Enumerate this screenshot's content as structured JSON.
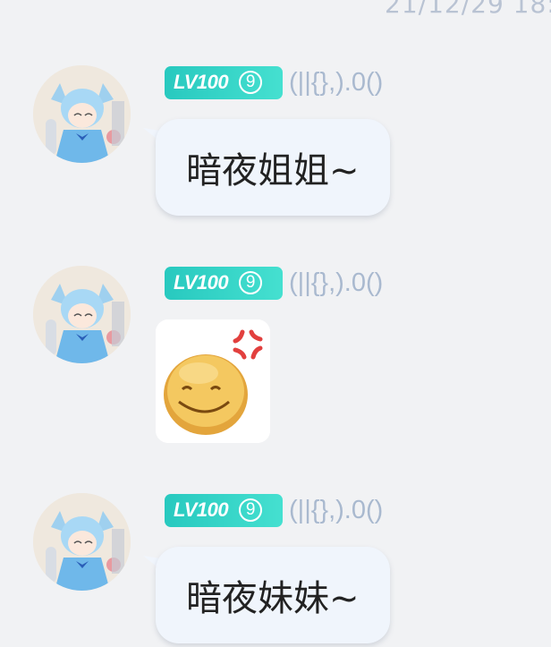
{
  "header": {
    "timestamp": "21/12/29 18:"
  },
  "messages": [
    {
      "type": "text",
      "level": "LV100",
      "level_icon": "9",
      "nickname": "(||{},).0()",
      "text": "暗夜姐姐~"
    },
    {
      "type": "sticker",
      "level": "LV100",
      "level_icon": "9",
      "nickname": "(||{},).0()",
      "sticker": "angry-smiley-face-sticker"
    },
    {
      "type": "text",
      "level": "LV100",
      "level_icon": "9",
      "nickname": "(||{},).0()",
      "text": "暗夜妹妹~"
    }
  ],
  "colors": {
    "background": "#f1f2f4",
    "bubble": "#f0f5fc",
    "badge": "#2ed3c6",
    "nickname": "#a9b9cf"
  }
}
